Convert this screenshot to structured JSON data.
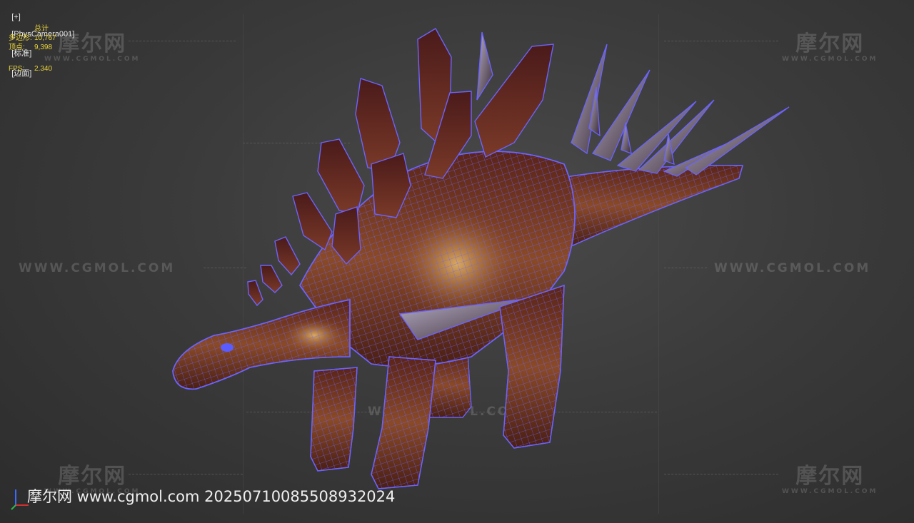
{
  "viewport": {
    "label_plus": "[+]",
    "label_camera": "[PhysCamera001]",
    "label_shading": "[标准]",
    "label_style": "[边面]"
  },
  "stats": {
    "header": "总计",
    "polygons_label": "多边形:",
    "polygons_value": "10,767",
    "vertices_label": "顶点:",
    "vertices_value": "9,398",
    "fps_label": "FPS:",
    "fps_value": "2.340"
  },
  "watermarks": {
    "logo_cn": "摩尔网",
    "logo_en": "WWW.CGMOL.COM",
    "url_text": "WWW.CGMOL.COM",
    "footer_text": "摩尔网 www.cgmol.com 2025071008550893202​4"
  },
  "colors": {
    "wire": "#6b63ff",
    "skin_dark": "#5a2418",
    "skin_mid": "#8a4a26",
    "skin_light": "#d7a35c",
    "stats_text": "#e8d23a"
  }
}
